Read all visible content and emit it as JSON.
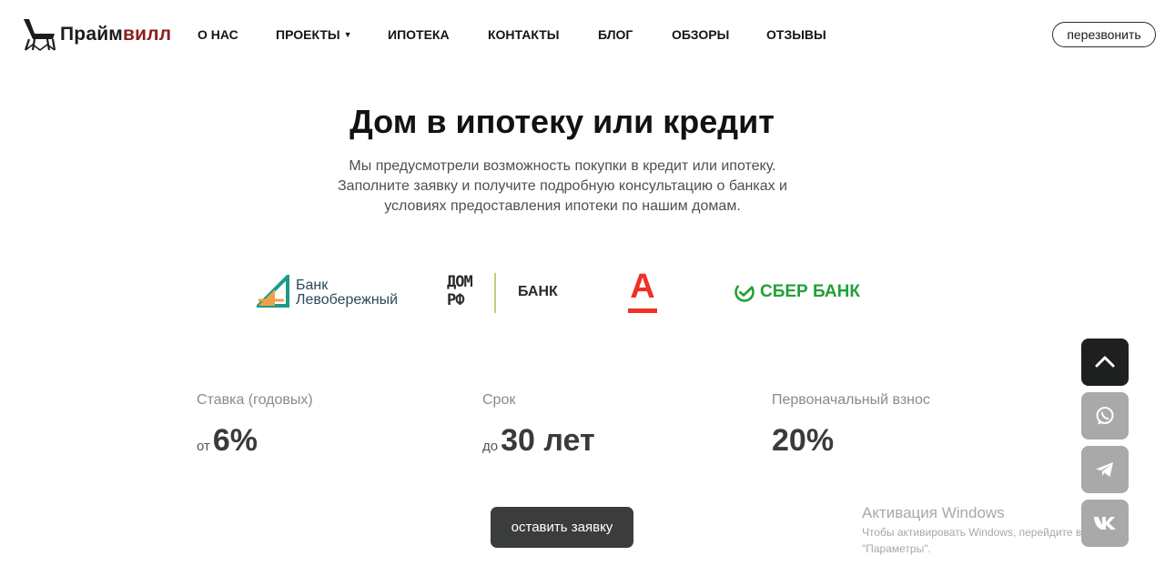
{
  "header": {
    "logo": {
      "text_part1": "Прайм",
      "text_part2": "вилл"
    },
    "nav": [
      {
        "label": "О НАС"
      },
      {
        "label": "ПРОЕКТЫ",
        "has_dropdown": true
      },
      {
        "label": "ИПОТЕКА"
      },
      {
        "label": "КОНТАКТЫ"
      },
      {
        "label": "БЛОГ"
      },
      {
        "label": "ОБЗОРЫ"
      },
      {
        "label": "ОТЗЫВЫ"
      }
    ],
    "callback_label": "перезвонить"
  },
  "hero": {
    "title": "Дом в ипотеку или кредит",
    "subtitle_lines": [
      "Мы предусмотрели возможность покупки в кредит или ипотеку.",
      "Заполните заявку и получите подробную консультацию о банках и",
      "условиях предоставления ипотеки по нашим домам."
    ]
  },
  "banks": {
    "levoberezhny": {
      "line1": "Банк",
      "line2": "Левобережный"
    },
    "domrf": {
      "mark_top": "ДОМ",
      "mark_bottom": "РФ",
      "label": "БАНК"
    },
    "alfa": {
      "letter": "А"
    },
    "sber": {
      "label": "СБЕР БАНК"
    }
  },
  "stats": [
    {
      "label": "Ставка (годовых)",
      "prefix": "от",
      "value": "6%"
    },
    {
      "label": "Срок",
      "prefix": "до",
      "value": "30 лет"
    },
    {
      "label": "Первоначальный взнос",
      "prefix": "",
      "value": "20%"
    }
  ],
  "cta_label": "оставить заявку",
  "side_buttons": [
    "chevron-up-icon",
    "whatsapp-icon",
    "telegram-icon",
    "vk-icon"
  ],
  "colors": {
    "logo_accent": "#8b1e1e",
    "cta_bg": "#3b3d3c",
    "levoberezhny_green": "#1a9a8a",
    "levoberezhny_orange": "#f0a04a",
    "alfa_red": "#ef3124",
    "sber_green": "#21a038"
  },
  "watermark": {
    "title": "Активация Windows",
    "line1": "Чтобы активировать Windows, перейдите в",
    "line2": "\"Параметры\"."
  }
}
